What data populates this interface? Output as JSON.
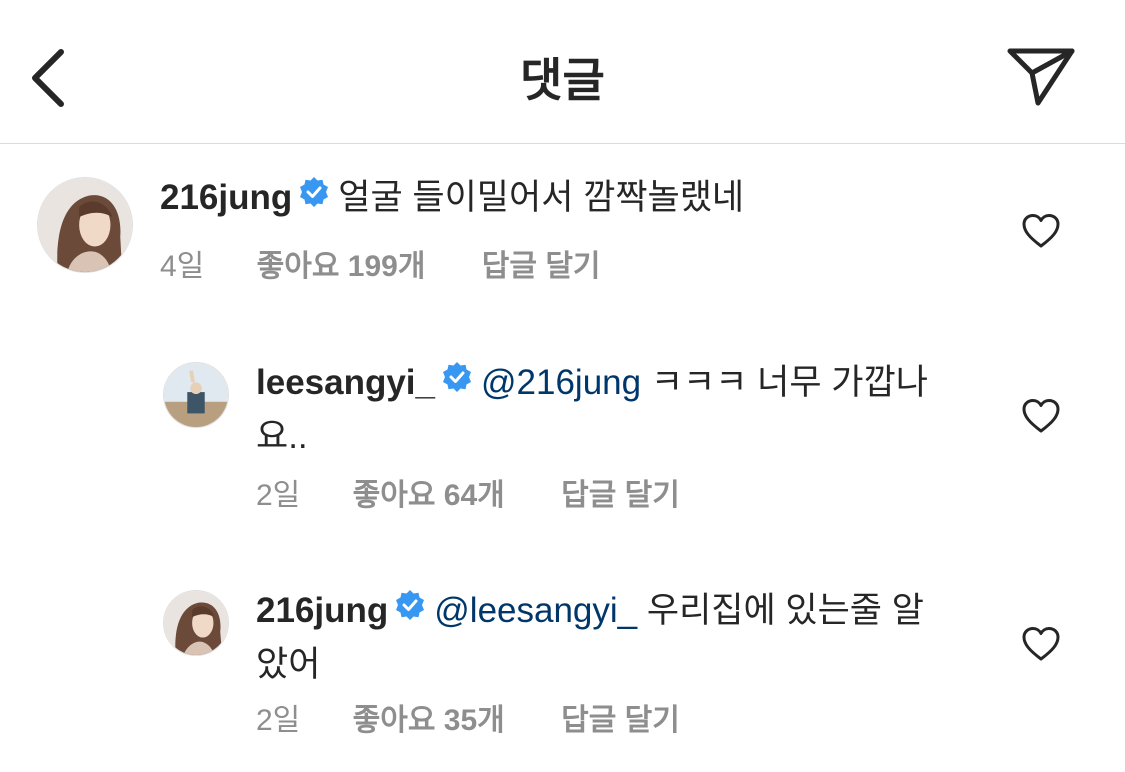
{
  "header": {
    "title": "댓글"
  },
  "comments": [
    {
      "username": "216jung",
      "mention": "",
      "text": "얼굴 들이밀어서 깜짝놀랬네",
      "time": "4일",
      "likes": "좋아요 199개",
      "reply": "답글 달기"
    },
    {
      "username": "leesangyi_",
      "mention": "@216jung",
      "text": "ㅋㅋㅋ 너무 가깝나요..",
      "time": "2일",
      "likes": "좋아요 64개",
      "reply": "답글 달기"
    },
    {
      "username": "216jung",
      "mention": "@leesangyi_",
      "text": "우리집에 있는줄 알았어",
      "time": "2일",
      "likes": "좋아요 35개",
      "reply": "답글 달기"
    }
  ],
  "colors": {
    "verified": "#3897f0",
    "mention": "#00376b",
    "meta": "#8e8e8e"
  },
  "icons": [
    "back-chevron-icon",
    "send-paper-plane-icon",
    "verified-badge-icon",
    "heart-outline-icon"
  ]
}
